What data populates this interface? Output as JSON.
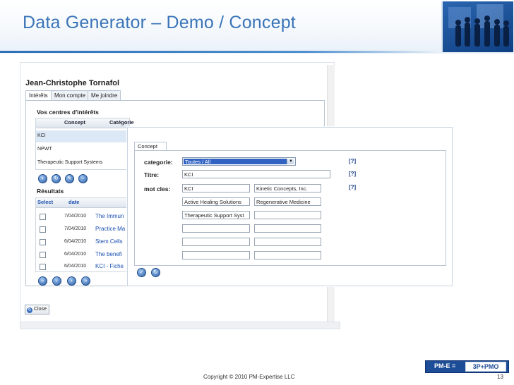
{
  "slide": {
    "title": "Data Generator – Demo / Concept",
    "copyright": "Copyright © 2010 PM-Expertise LLC",
    "page_number": "13",
    "badge_left": "PM-E =",
    "badge_right": "3P+PMO"
  },
  "app": {
    "user_name": "Jean-Christophe Tornafol",
    "tabs": [
      {
        "label": "Intérêts"
      },
      {
        "label": "Mon compte"
      },
      {
        "label": "Me joindre"
      }
    ],
    "interests": {
      "title": "Vos centres d'intérêts",
      "columns": [
        "Concept",
        "Catégorie"
      ],
      "rows": [
        "KCI",
        "NPWT",
        "Therapeutic Support Systems"
      ]
    },
    "results": {
      "title": "Résultats",
      "columns": [
        "Select",
        "date"
      ],
      "rows": [
        {
          "date": "7/04/2010",
          "title": "The Immun"
        },
        {
          "date": "7/04/2010",
          "title": "Practice Ma"
        },
        {
          "date": "6/04/2010",
          "title": "Stem Cells"
        },
        {
          "date": "6/04/2010",
          "title": "The benefi"
        },
        {
          "date": "6/04/2010",
          "title": "KCI - Fiche"
        }
      ]
    },
    "close_label": "Close"
  },
  "popup": {
    "tab_label": "Concept",
    "category_label": "categorie:",
    "category_value": "Toutes / All",
    "title_label": "Titre:",
    "title_value": "KCI",
    "keywords_label": "mot cles:",
    "keywords": [
      "KCI",
      "Kinetic Concepts, Inc.",
      "Active Healing Solutions",
      "Regenerative Medicine",
      "Therapeutic Support Syst",
      "",
      "",
      "",
      "",
      "",
      "",
      ""
    ],
    "help": "[?]"
  },
  "colors": {
    "title": "#3a74b8",
    "accent_bar": "#2f6fb5",
    "badge_bg": "#1d4d96",
    "select_highlight": "#3163c2"
  }
}
